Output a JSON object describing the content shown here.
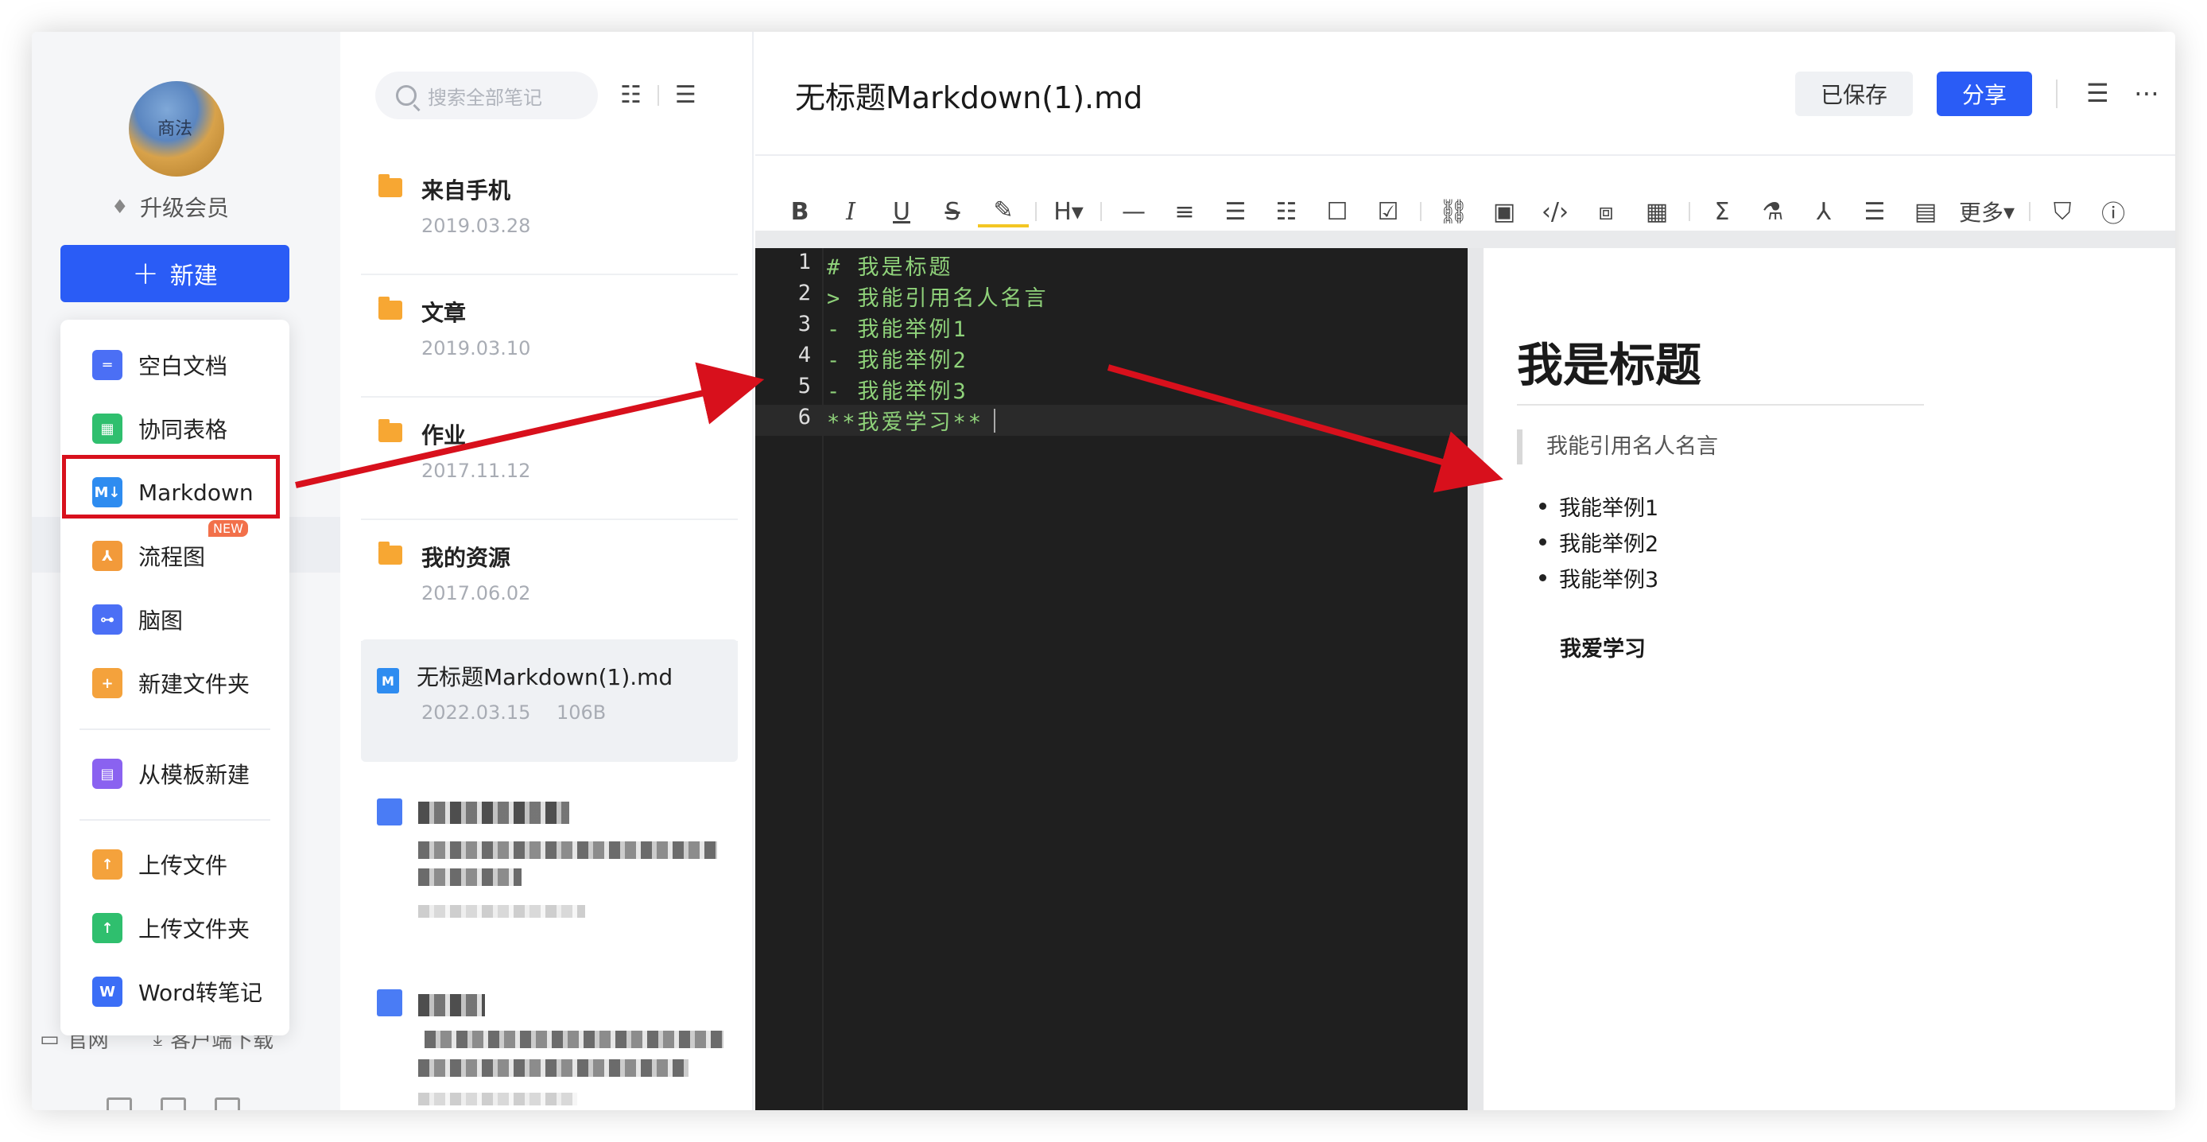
{
  "sidebar": {
    "avatar_text": "商法",
    "upgrade_label": "升级会员",
    "new_button_label": "新建",
    "footer": {
      "website": "官网",
      "client_download": "客户端下载"
    }
  },
  "new_menu": {
    "items": [
      {
        "label": "空白文档",
        "icon": "document-icon",
        "color": "#4b6ff5"
      },
      {
        "label": "协同表格",
        "icon": "table-icon",
        "color": "#2fbf6e"
      },
      {
        "label": "Markdown",
        "icon": "markdown-icon",
        "color": "#2e8cf0"
      },
      {
        "label": "流程图",
        "icon": "flowchart-icon",
        "color": "#f29a3a",
        "badge": "NEW"
      },
      {
        "label": "脑图",
        "icon": "mindmap-icon",
        "color": "#4b6ff5"
      },
      {
        "label": "新建文件夹",
        "icon": "folder-plus-icon",
        "color": "#f4a23c"
      },
      {
        "label": "从模板新建",
        "icon": "template-icon",
        "color": "#8a62f0"
      },
      {
        "label": "上传文件",
        "icon": "upload-file-icon",
        "color": "#f4a23c"
      },
      {
        "label": "上传文件夹",
        "icon": "upload-folder-icon",
        "color": "#2fbf6e"
      },
      {
        "label": "Word转笔记",
        "icon": "word-icon",
        "color": "#3b6ef6"
      }
    ]
  },
  "note_list": {
    "search_placeholder": "搜索全部笔记",
    "folders": [
      {
        "title": "来自手机",
        "date": "2019.03.28"
      },
      {
        "title": "文章",
        "date": "2019.03.10"
      },
      {
        "title": "作业",
        "date": "2017.11.12"
      },
      {
        "title": "我的资源",
        "date": "2017.06.02"
      }
    ],
    "active_note": {
      "title": "无标题Markdown(1).md",
      "date": "2022.03.15",
      "size": "106B"
    }
  },
  "editor": {
    "doc_title": "无标题Markdown(1).md",
    "saved_label": "已保存",
    "share_label": "分享",
    "toolbar_more": "更多",
    "code_lines": [
      {
        "n": "1",
        "text": "# 我是标题"
      },
      {
        "n": "2",
        "text": "> 我能引用名人名言"
      },
      {
        "n": "3",
        "text": "- 我能举例1"
      },
      {
        "n": "4",
        "text": "- 我能举例2"
      },
      {
        "n": "5",
        "text": "- 我能举例3"
      },
      {
        "n": "6",
        "text": "**我爱学习**"
      }
    ]
  },
  "preview": {
    "heading": "我是标题",
    "quote": "我能引用名人名言",
    "list": [
      "我能举例1",
      "我能举例2",
      "我能举例3"
    ],
    "bold": "我爱学习"
  },
  "colors": {
    "accent": "#2a5cf6",
    "annotation_red": "#d8101c",
    "code_green": "#8fd27a",
    "code_bg": "#1f1f1f"
  }
}
